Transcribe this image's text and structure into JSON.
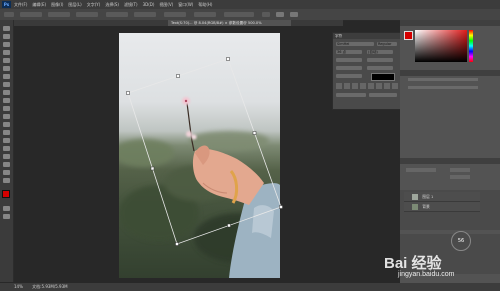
{
  "menubar": {
    "logo": "Ps",
    "items": [
      "文件(F)",
      "编辑(E)",
      "图像(I)",
      "图层(L)",
      "文字(Y)",
      "选择(S)",
      "滤镜(T)",
      "3D(D)",
      "视图(V)",
      "窗口(W)",
      "帮助(H)"
    ]
  },
  "tab": {
    "title": "Text(S:70)... @ 8.04(RGB/8#) × 参数设置@ 500.0%"
  },
  "status": {
    "zoom": "14%",
    "doc": "文档:5.93M/5.93M"
  },
  "character_panel": {
    "title": "字符",
    "font": "SimHei",
    "style": "Regular",
    "size": "36 点",
    "leading": "(自动)",
    "color": "#000000"
  },
  "color_panel": {
    "fg": "#d40000",
    "bg": "#ffffff"
  },
  "layers_panel": {
    "items": [
      {
        "label": "图层 1",
        "thumb": "#9ea69c"
      },
      {
        "label": "背景",
        "thumb": "#7c8a75"
      }
    ]
  },
  "watermark": {
    "logo": "Bai 经验",
    "url": "jingyan.baidu.com"
  },
  "badge": {
    "value": "56"
  }
}
